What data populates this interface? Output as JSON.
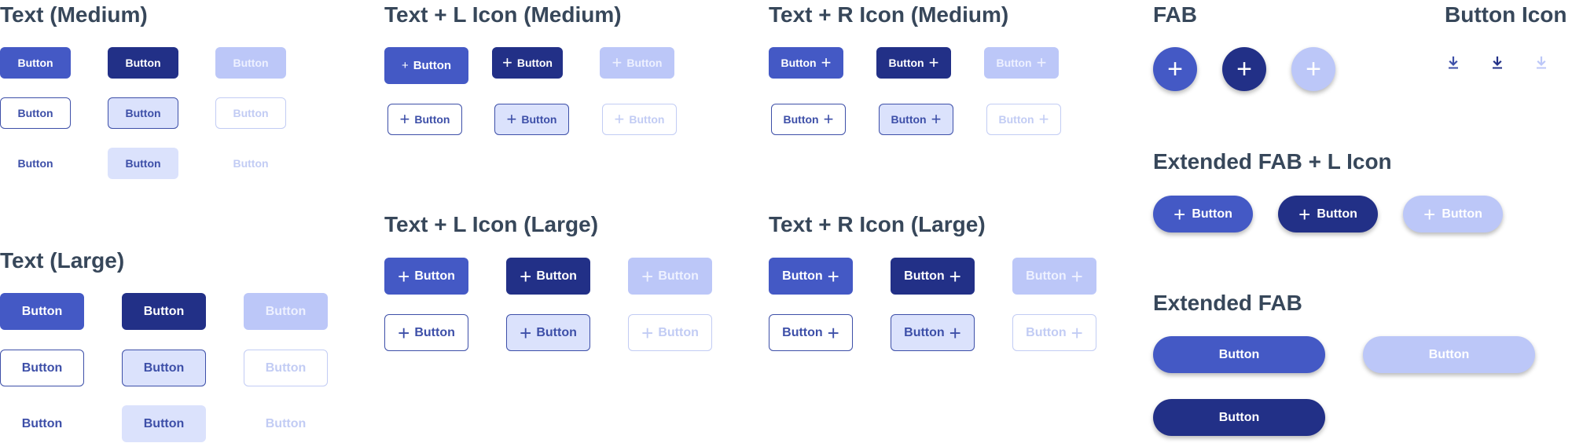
{
  "colors": {
    "primary": "#4459c5",
    "primary_dark": "#223087",
    "primary_disabled": "#bcc7f8",
    "outline": "#3d4fa8",
    "selected_bg": "#dbe2fc",
    "title": "#37475a"
  },
  "sections": {
    "text_medium": "Text (Medium)",
    "text_large": "Text (Large)",
    "text_l_icon_medium": "Text + L Icon (Medium)",
    "text_l_icon_large": "Text + L Icon (Large)",
    "text_r_icon_medium": "Text + R Icon (Medium)",
    "text_r_icon_large": "Text + R Icon (Large)",
    "fab": "FAB",
    "button_icon": "Button Icon",
    "extended_fab_l_icon": "Extended FAB + L Icon",
    "extended_fab": "Extended FAB"
  },
  "button_label": "Button",
  "plus_glyph": "+",
  "icons": {
    "plus": "plus-icon",
    "download": "download-icon"
  }
}
